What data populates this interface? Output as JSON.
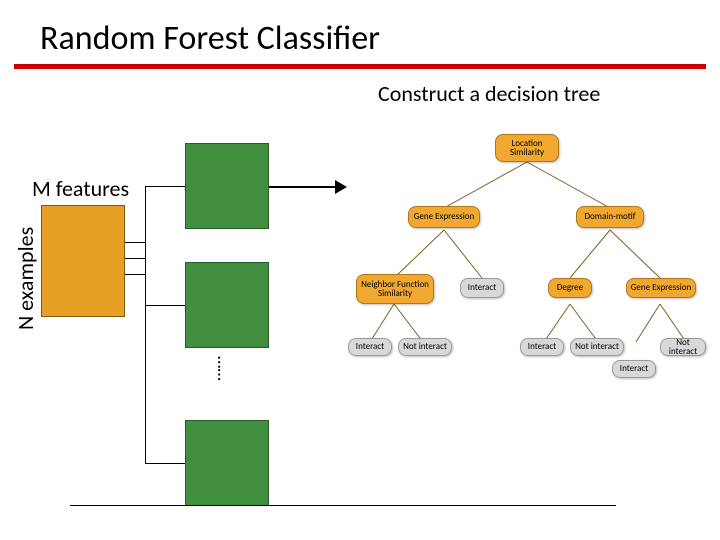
{
  "title": "Random Forest Classifier",
  "subtitle": "Construct a decision tree",
  "labels": {
    "m_features": "M features",
    "n_examples": "N examples",
    "vdots": "……"
  },
  "tree": {
    "root": "Location Similarity",
    "l": "Gene Expression",
    "r": "Domain-motif",
    "ll": "Neighbor Function Similarity",
    "lr": "Interact",
    "rl": "Degree",
    "rr": "Gene Expression",
    "leaf1": "Interact",
    "leaf2": "Not interact",
    "leaf3": "Interact",
    "leaf4": "Not interact",
    "leaf5": "Interact",
    "leaf6": "Not interact"
  }
}
